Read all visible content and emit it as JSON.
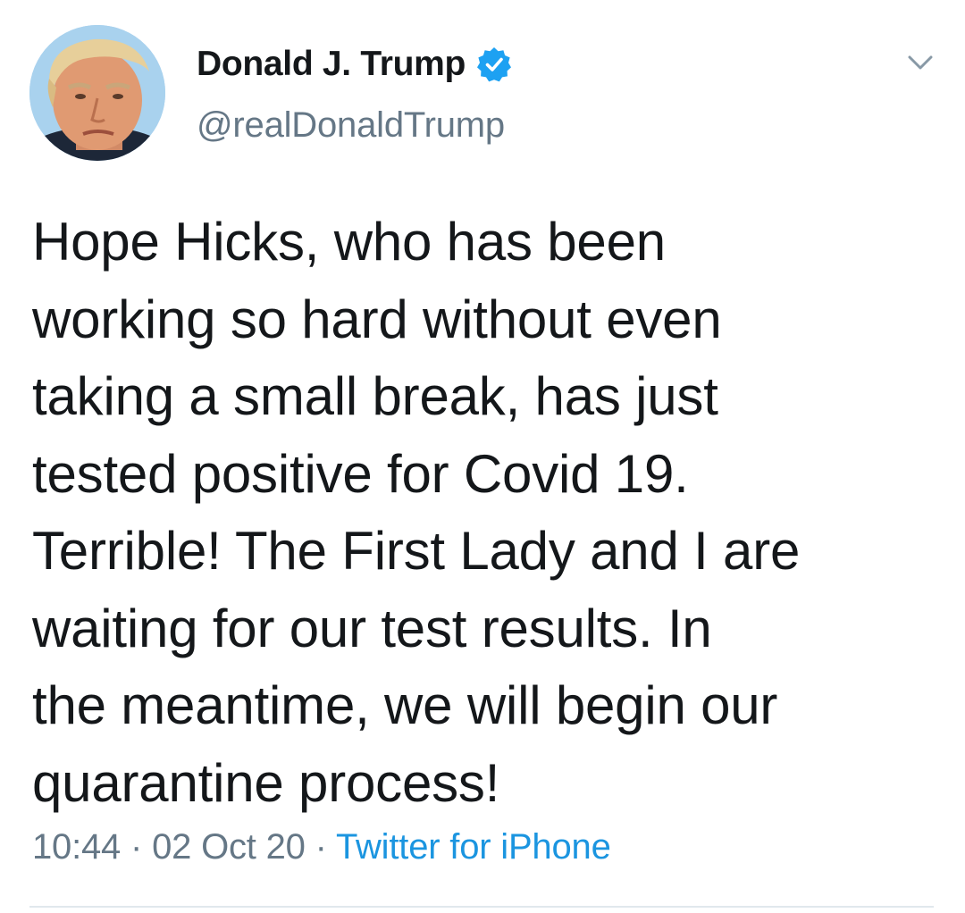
{
  "author": {
    "display_name": "Donald J. Trump",
    "handle": "@realDonaldTrump",
    "verified": true,
    "avatar_icon": "profile-photo"
  },
  "tweet": {
    "text": "Hope Hicks, who has been\nworking so hard without even\ntaking a small break, has just\ntested positive for Covid 19.\nTerrible! The First Lady and I are\nwaiting for our test results. In\nthe meantime, we will begin our\nquarantine process!",
    "time": "10:44",
    "separator": "·",
    "date": "02 Oct 20",
    "source": "Twitter for iPhone"
  },
  "icons": {
    "verified": "verified-badge-icon",
    "more": "chevron-down-icon"
  },
  "colors": {
    "text": "#14171a",
    "secondary": "#657786",
    "link": "#1b95e0",
    "verified": "#1da1f2",
    "divider": "#e1e8ed"
  }
}
